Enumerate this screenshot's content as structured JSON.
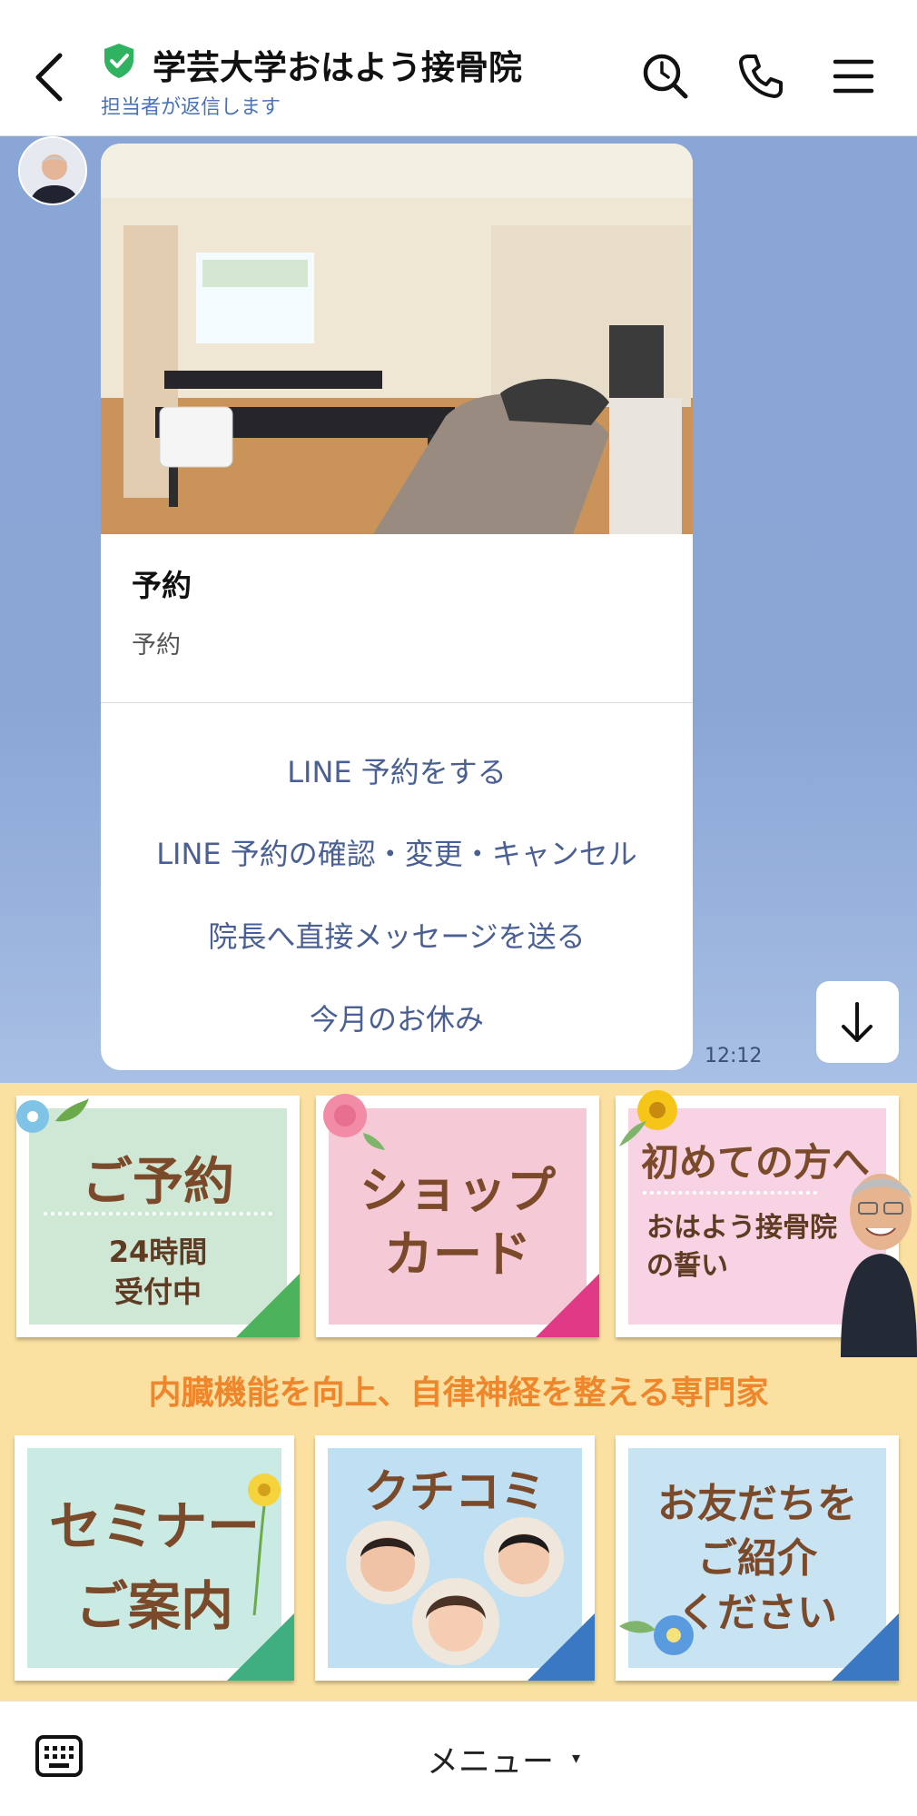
{
  "header": {
    "title": "学芸大学おはよう接骨院",
    "subtitle": "担当者が返信します",
    "icons": [
      "back-icon",
      "verified-shield-icon",
      "search-icon",
      "phone-icon",
      "menu-icon"
    ]
  },
  "message": {
    "card_title": "予約",
    "card_description": "予約",
    "actions": [
      "LINE 予約をする",
      "LINE 予約の確認・変更・キャンセル",
      "院長へ直接メッセージを送る",
      "今月のお休み"
    ],
    "time": "12:12"
  },
  "rich_menu": {
    "tiles": [
      {
        "title": "ご予約",
        "sub": "24時間\n受付中",
        "color": "#cfe8d6",
        "corner": "#4cb35c"
      },
      {
        "title": "ショップ\nカード",
        "sub": "",
        "color": "#f6c9d6",
        "corner": "#e03a86"
      },
      {
        "title": "初めての方へ",
        "sub": "おはよう接骨院\nの誓い",
        "color": "#f8d3e3",
        "corner": "#4cb35c"
      },
      {
        "title": "セミナー\nご案内",
        "sub": "",
        "color": "#c9ebe3",
        "corner": "#3fae80"
      },
      {
        "title": "クチコミ",
        "sub": "",
        "color": "#bfe0f2",
        "corner": "#3a78c4"
      },
      {
        "title": "お友だちを\nご紹介\nください",
        "sub": "",
        "color": "#c8e4f3",
        "corner": "#3a78c4"
      }
    ],
    "tagline": "内臓機能を向上、自律神経を整える専門家"
  },
  "bottom_bar": {
    "menu_label": "メニュー",
    "caret": "▾"
  },
  "colors": {
    "chat_bg": "#89a6d6",
    "action_text": "#4a5f93",
    "verified": "#2fb360",
    "rich_bg": "#fbe1a1",
    "tagline": "#f0862b"
  }
}
